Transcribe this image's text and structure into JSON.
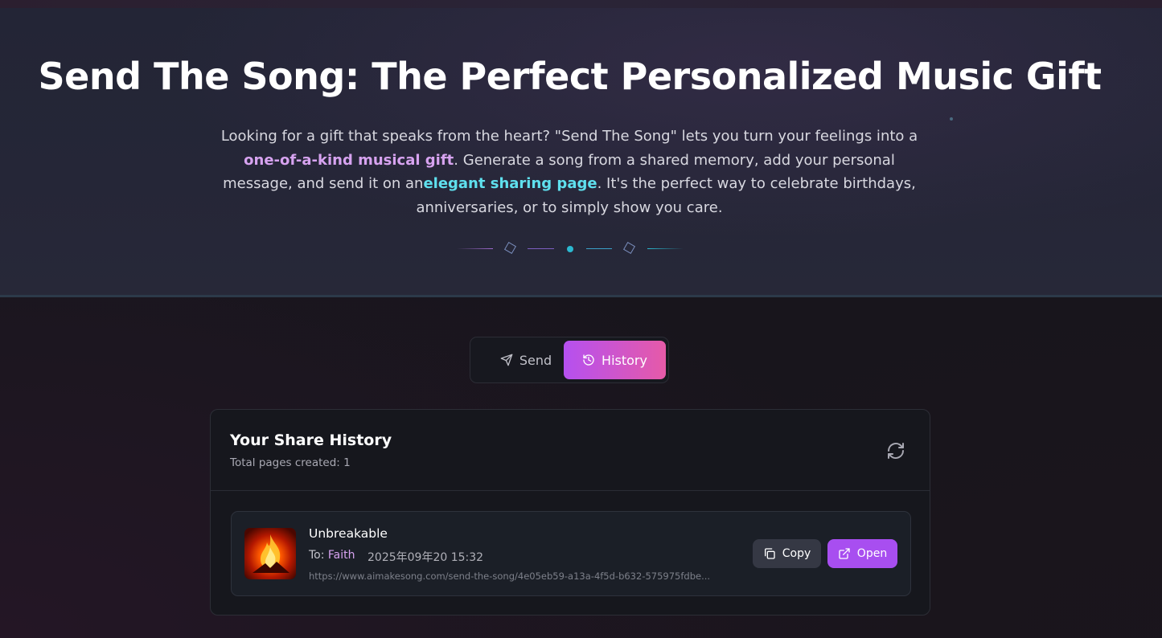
{
  "hero": {
    "title": "Send The Song: The Perfect Personalized Music Gift",
    "desc_part1": "Looking for a gift that speaks from the heart? \"Send The Song\" lets you turn your feelings into a ",
    "desc_highlight1": "one-of-a-kind musical gift",
    "desc_part2": ". Generate a song from a shared memory, add your personal message, and send it on an",
    "desc_highlight2": "elegant sharing page",
    "desc_part3": ". It's the perfect way to celebrate birthdays, anniversaries, or to simply show you care."
  },
  "tabs": [
    {
      "label": "Send",
      "icon": "send-icon",
      "active": false
    },
    {
      "label": "History",
      "icon": "history-icon",
      "active": true
    }
  ],
  "history": {
    "title": "Your Share History",
    "subtitle": "Total pages created: 1",
    "items": [
      {
        "title": "Unbreakable",
        "to_label": "To: ",
        "recipient": "Faith",
        "date": "2025年09年20 15:32",
        "url": "https://www.aimakesong.com/send-the-song/4e05eb59-a13a-4f5d-b632-575975fdbe...",
        "copy_label": "Copy",
        "open_label": "Open"
      }
    ]
  },
  "colors": {
    "accent_purple": "#a84ef0",
    "accent_pink": "#e65aa8",
    "highlight_purple": "#d7a3f0",
    "highlight_cyan": "#5fe0ee"
  }
}
